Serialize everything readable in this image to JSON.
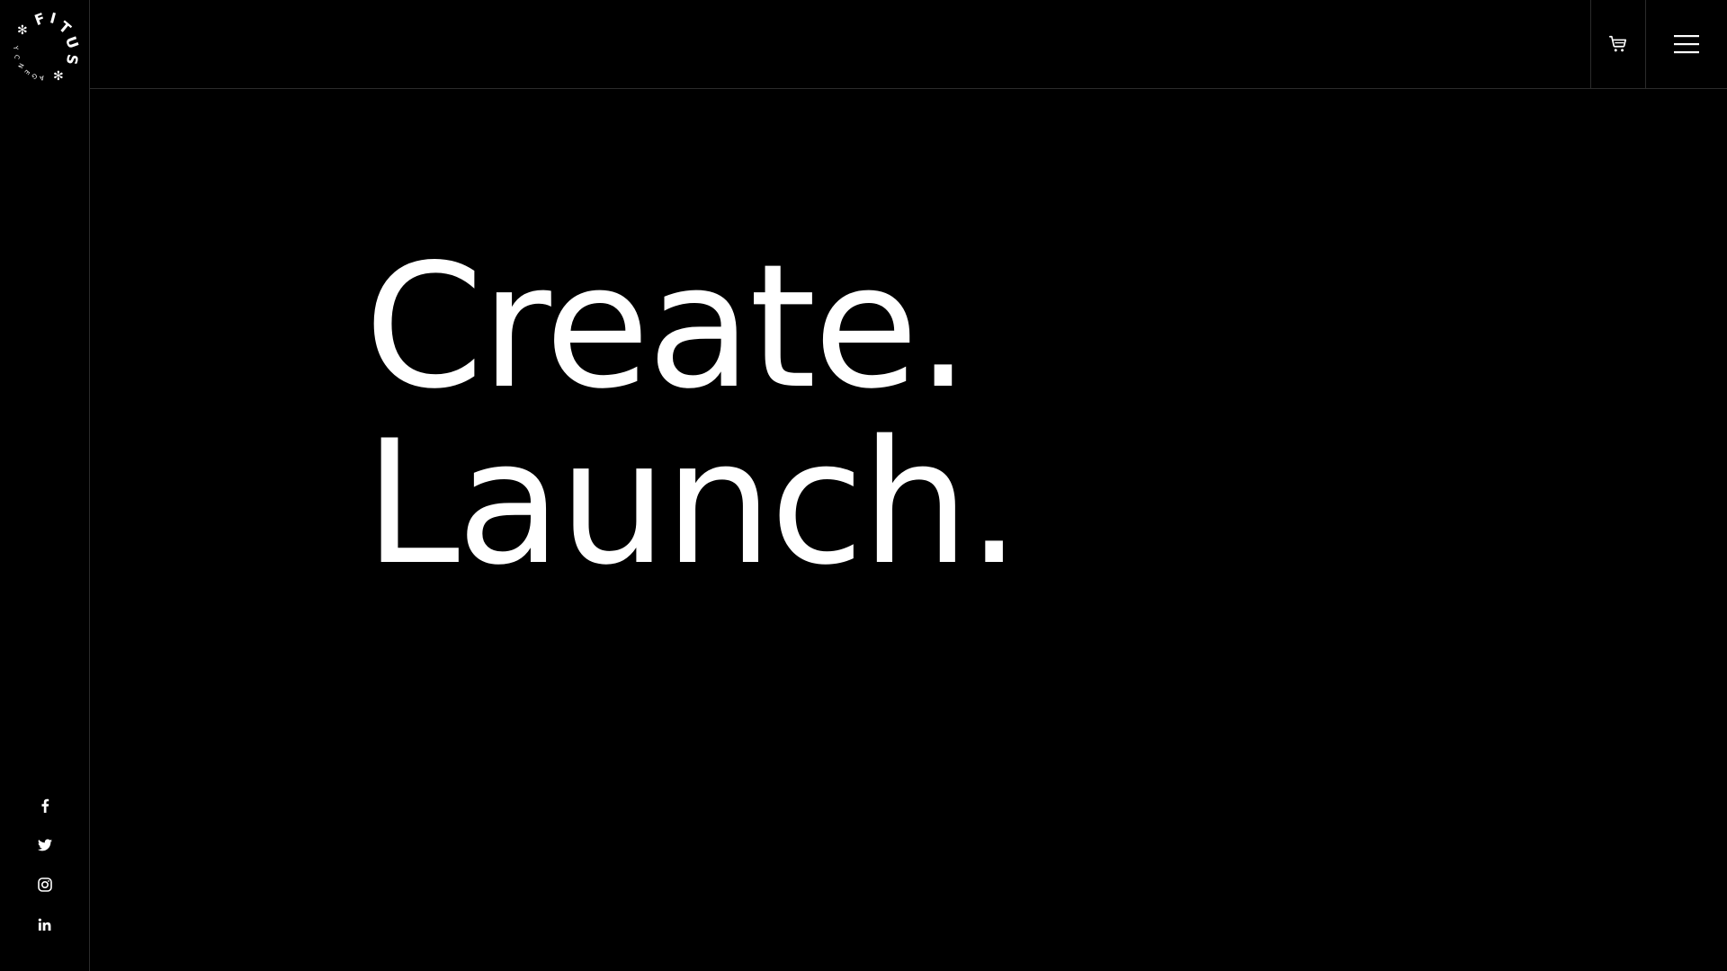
{
  "logo": {
    "letters": "FITUS",
    "sub": "AGENCY",
    "star": "✻"
  },
  "hero": {
    "line1": "Create.",
    "line2": "Launch."
  },
  "header": {
    "cart_icon": "cart-icon",
    "menu_icon": "hamburger-menu-icon"
  },
  "social": [
    {
      "name": "facebook",
      "icon": "facebook-icon"
    },
    {
      "name": "twitter",
      "icon": "twitter-icon"
    },
    {
      "name": "instagram",
      "icon": "instagram-icon"
    },
    {
      "name": "linkedin",
      "icon": "linkedin-icon"
    }
  ],
  "colors": {
    "background": "#000000",
    "foreground": "#ffffff",
    "divider": "#2b2b2b"
  }
}
